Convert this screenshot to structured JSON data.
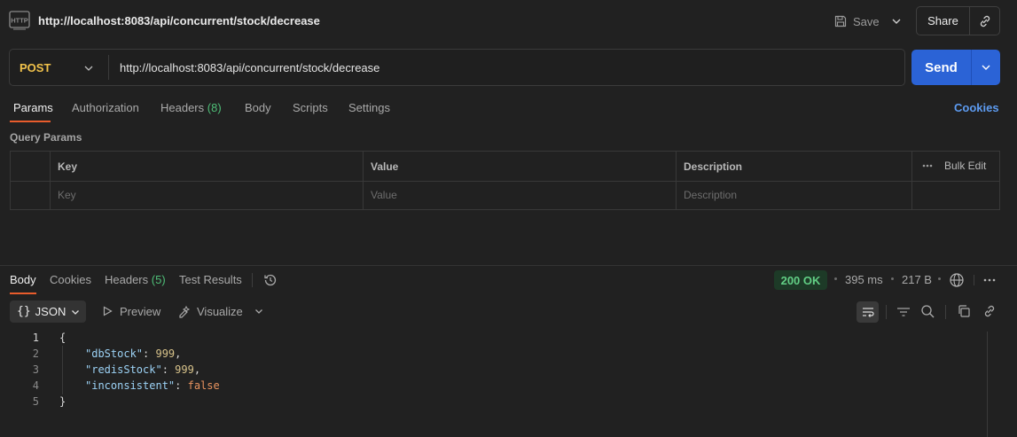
{
  "top": {
    "title": "http://localhost:8083/api/concurrent/stock/decrease",
    "save_label": "Save",
    "share_label": "Share"
  },
  "request": {
    "method": "POST",
    "url": "http://localhost:8083/api/concurrent/stock/decrease",
    "send_label": "Send"
  },
  "tabs": {
    "params": "Params",
    "authorization": "Authorization",
    "headers": "Headers",
    "headers_count": "(8)",
    "body": "Body",
    "scripts": "Scripts",
    "settings": "Settings",
    "cookies": "Cookies"
  },
  "query": {
    "title": "Query Params",
    "columns": [
      "Key",
      "Value",
      "Description"
    ],
    "bulk_edit": "Bulk Edit",
    "placeholders": [
      "Key",
      "Value",
      "Description"
    ]
  },
  "response": {
    "tabs": {
      "body": "Body",
      "cookies": "Cookies",
      "headers": "Headers",
      "headers_count": "(5)",
      "test_results": "Test Results"
    },
    "status": "200 OK",
    "time": "395 ms",
    "size": "217 B",
    "format": "JSON",
    "preview": "Preview",
    "visualize": "Visualize",
    "line_numbers": [
      "1",
      "2",
      "3",
      "4",
      "5"
    ],
    "code": {
      "open": "{",
      "close": "}",
      "lines": [
        {
          "key": "\"dbStock\"",
          "value": "999",
          "trail": ","
        },
        {
          "key": "\"redisStock\"",
          "value": "999",
          "trail": ","
        },
        {
          "key": "\"inconsistent\"",
          "value": "false",
          "trail": ""
        }
      ]
    }
  },
  "colors": {
    "method": "#f1c24b",
    "send": "#2b63d6",
    "accent_underline": "#e85c2c",
    "status_ok": "#62cf85",
    "link": "#5d9bf0"
  }
}
